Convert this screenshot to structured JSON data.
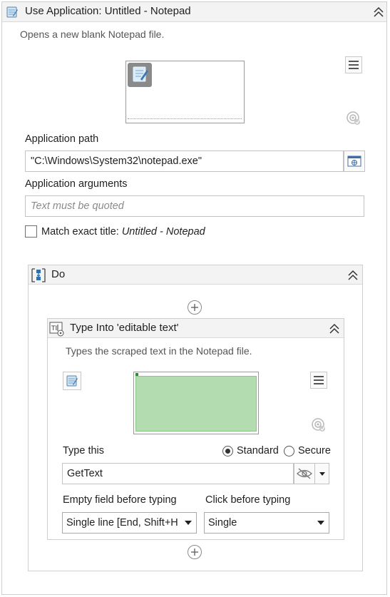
{
  "activity": {
    "title": "Use Application: Untitled - Notepad",
    "description": "Opens a new blank Notepad file.",
    "app_path_label": "Application path",
    "app_path_value": "\"C:\\Windows\\System32\\notepad.exe\"",
    "app_args_label": "Application arguments",
    "app_args_placeholder": "Text must be quoted",
    "match_title_prefix": "Match exact title: ",
    "match_title_value": "Untitled - Notepad",
    "match_title_checked": false
  },
  "sequence": {
    "title": "Do"
  },
  "type_into": {
    "title": "Type Into 'editable text'",
    "description": "Types the scraped text in the Notepad file.",
    "type_this_label": "Type this",
    "type_this_value": "GetText",
    "radio_standard": "Standard",
    "radio_secure": "Secure",
    "selected_mode": "Standard",
    "empty_field_label": "Empty field before typing",
    "empty_field_value": "Single line [End, Shift+H",
    "click_before_label": "Click before typing",
    "click_before_value": "Single"
  },
  "colors": {
    "header_bg": "#f3f3f3",
    "target_highlight": "#b3dcb1",
    "border": "#cfcfcf"
  },
  "icons": {
    "app": "notepad-icon",
    "collapse": "chevron-double-up-icon",
    "menu": "hamburger-menu-icon",
    "target": "target-icon",
    "browse": "browse-window-icon",
    "sequence": "sequence-icon",
    "type_into": "type-into-icon",
    "add": "plus-circle-icon",
    "visibility": "eye-slash-icon",
    "dropdown": "caret-down-icon"
  }
}
